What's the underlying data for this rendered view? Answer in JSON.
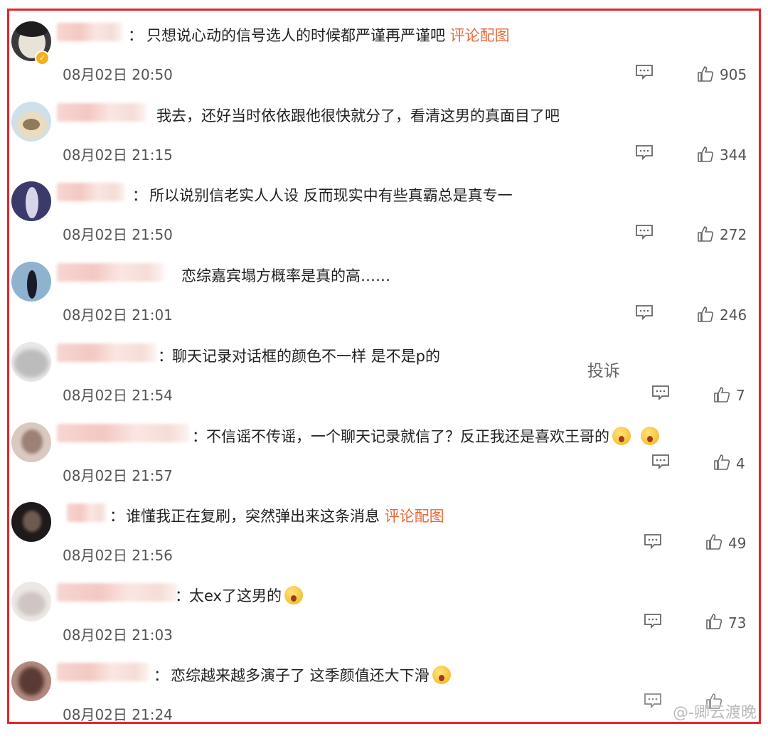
{
  "comments": [
    {
      "text": "只想说心动的信号选人的时候都严谨再严谨吧",
      "link": "评论配图",
      "date": "08月02日 20:50",
      "likes": "905",
      "verified": true
    },
    {
      "text": "我去，还好当时依依跟他很快就分了，看清这男的真面目了吧",
      "link": "",
      "date": "08月02日 21:15",
      "likes": "344"
    },
    {
      "text": "所以说别信老实人人设 反而现实中有些真霸总是真专一",
      "link": "",
      "date": "08月02日 21:50",
      "likes": "272"
    },
    {
      "text": "恋综嘉宾塌方概率是真的高……",
      "link": "",
      "date": "08月02日 21:01",
      "likes": "246"
    },
    {
      "text": "聊天记录对话框的颜色不一样 是不是p的",
      "link": "",
      "date": "08月02日 21:54",
      "likes": "7",
      "report": "投诉"
    },
    {
      "text": "不信谣不传谣，一个聊天记录就信了？反正我还是喜欢王哥的",
      "link": "",
      "date": "08月02日 21:57",
      "likes": "4"
    },
    {
      "text": "谁懂我正在复刷，突然弹出来这条消息",
      "link": "评论配图",
      "date": "08月02日 21:56",
      "likes": "49"
    },
    {
      "text": "太ex了这男的",
      "link": "",
      "date": "08月02日 21:03",
      "likes": "73"
    },
    {
      "text": "恋综越来越多演子了 这季颜值还大下滑",
      "link": "",
      "date": "08月02日 21:24",
      "likes": ""
    }
  ],
  "colon": "：",
  "verified_mark": "✓",
  "watermark": "@-卿云渡晚",
  "colors": {
    "border": "#e0262c",
    "link": "#e8693a",
    "meta": "#555555"
  },
  "icons": {
    "reply": "comment-icon",
    "like": "thumbs-up-icon"
  }
}
